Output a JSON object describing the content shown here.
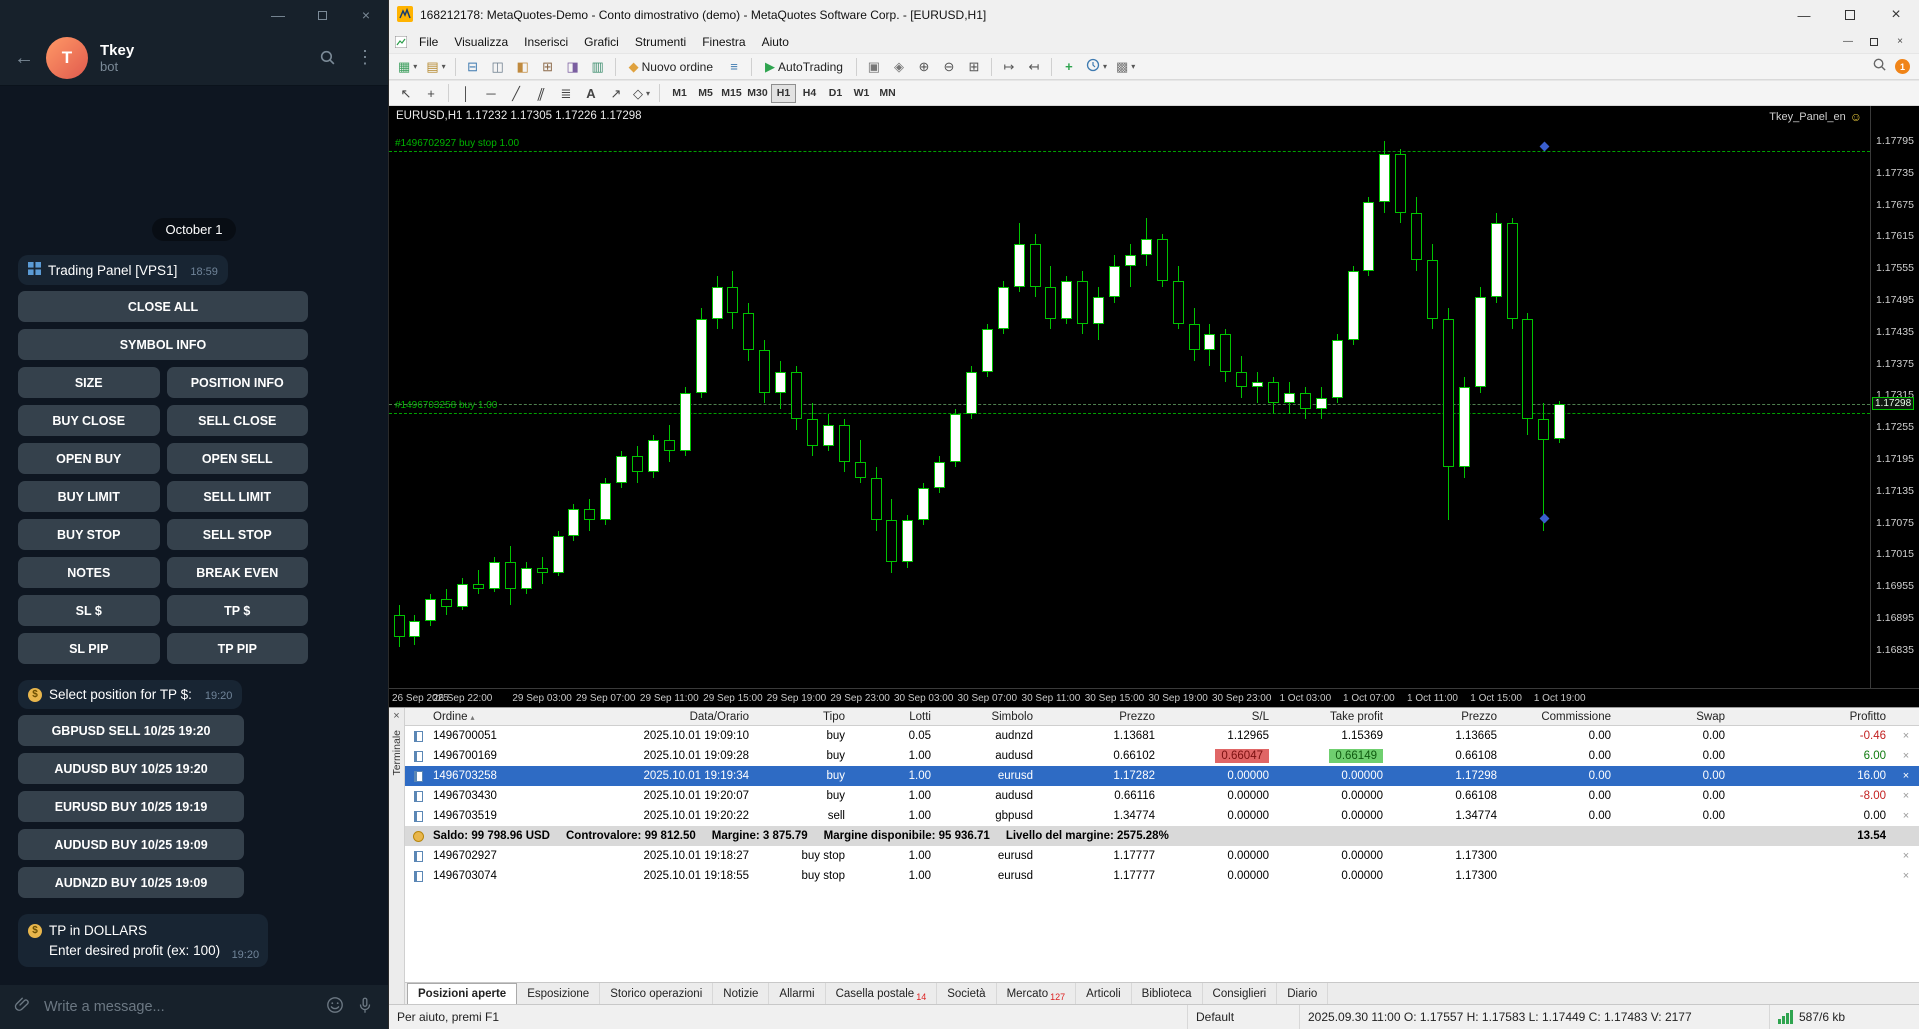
{
  "telegram": {
    "header": {
      "title": "Tkey",
      "subtitle": "bot",
      "avatar_letter": "T"
    },
    "date_separator": "October 1",
    "messages": {
      "panel": {
        "text": "Trading Panel [VPS1]",
        "time": "18:59"
      },
      "select": {
        "text": "Select position for TP $:",
        "time": "19:20"
      },
      "tp": {
        "line1": "TP in DOLLARS",
        "line2": "Enter desired profit (ex: 100)",
        "time": "19:20"
      }
    },
    "keyboard_rows": [
      [
        "CLOSE ALL"
      ],
      [
        "SYMBOL INFO"
      ],
      [
        "SIZE",
        "POSITION INFO"
      ],
      [
        "BUY CLOSE",
        "SELL CLOSE"
      ],
      [
        "OPEN BUY",
        "OPEN SELL"
      ],
      [
        "BUY LIMIT",
        "SELL LIMIT"
      ],
      [
        "BUY STOP",
        "SELL STOP"
      ],
      [
        "NOTES",
        "BREAK EVEN"
      ],
      [
        "SL $",
        "TP $"
      ],
      [
        "SL PIP",
        "TP PIP"
      ]
    ],
    "position_buttons": [
      "GBPUSD SELL 10/25 19:20",
      "AUDUSD BUY 10/25 19:20",
      "EURUSD BUY 10/25 19:19",
      "AUDUSD BUY 10/25 19:09",
      "AUDNZD BUY 10/25 19:09"
    ],
    "composer": {
      "placeholder": "Write a message..."
    }
  },
  "mt5": {
    "titlebar": {
      "title": "168212178: MetaQuotes-Demo - Conto dimostrativo (demo) - MetaQuotes Software Corp. - [EURUSD,H1]"
    },
    "menu": [
      "File",
      "Visualizza",
      "Inserisci",
      "Grafici",
      "Strumenti",
      "Finestra",
      "Aiuto"
    ],
    "toolbar": {
      "new_order_label": "Nuovo ordine",
      "autotrading_label": "AutoTrading",
      "notification_count": "1"
    },
    "timeframes": {
      "items": [
        "M1",
        "M5",
        "M15",
        "M30",
        "H1",
        "H4",
        "D1",
        "W1",
        "MN"
      ],
      "active": "H1"
    },
    "chart": {
      "info_line": "EURUSD,H1 1.17232 1.17305 1.17226 1.17298",
      "ea_label": "Tkey_Panel_en",
      "orders": [
        {
          "label": "#1496702927 buy stop 1.00",
          "price": 1.17777
        },
        {
          "label": "#1496703258 buy 1.00",
          "price": 1.17282
        }
      ],
      "current_price": 1.17298,
      "markers": [
        {
          "bar": 72,
          "price": 1.17784
        },
        {
          "bar": 72,
          "price": 1.17082
        }
      ],
      "price_axis": {
        "top_price": 1.17861,
        "bottom_price": 1.16763,
        "labels": [
          "1.17795",
          "1.17735",
          "1.17675",
          "1.17615",
          "1.17555",
          "1.17495",
          "1.17435",
          "1.17375",
          "1.17315",
          "1.17255",
          "1.17195",
          "1.17135",
          "1.17075",
          "1.17015",
          "1.16955",
          "1.16895",
          "1.16835"
        ]
      },
      "time_labels": [
        {
          "text": "26 Sep 2025",
          "bar": 0
        },
        {
          "text": "26 Sep 22:00",
          "bar": 4
        },
        {
          "text": "29 Sep 03:00",
          "bar": 9
        },
        {
          "text": "29 Sep 07:00",
          "bar": 13
        },
        {
          "text": "29 Sep 11:00",
          "bar": 17
        },
        {
          "text": "29 Sep 15:00",
          "bar": 21
        },
        {
          "text": "29 Sep 19:00",
          "bar": 25
        },
        {
          "text": "29 Sep 23:00",
          "bar": 29
        },
        {
          "text": "30 Sep 03:00",
          "bar": 33
        },
        {
          "text": "30 Sep 07:00",
          "bar": 37
        },
        {
          "text": "30 Sep 11:00",
          "bar": 41
        },
        {
          "text": "30 Sep 15:00",
          "bar": 45
        },
        {
          "text": "30 Sep 19:00",
          "bar": 49
        },
        {
          "text": "30 Sep 23:00",
          "bar": 53
        },
        {
          "text": "1 Oct 03:00",
          "bar": 57
        },
        {
          "text": "1 Oct 07:00",
          "bar": 61
        },
        {
          "text": "1 Oct 11:00",
          "bar": 65
        },
        {
          "text": "1 Oct 15:00",
          "bar": 69
        },
        {
          "text": "1 Oct 19:00",
          "bar": 73
        }
      ]
    },
    "chart_data": {
      "type": "candlestick",
      "symbol": "EURUSD",
      "timeframe": "H1",
      "ylim": [
        1.16763,
        1.17861
      ],
      "ohlc": [
        [
          1.169,
          1.1692,
          1.1684,
          1.1686
        ],
        [
          1.1686,
          1.169,
          1.16845,
          1.1689
        ],
        [
          1.1689,
          1.1694,
          1.1688,
          1.1693
        ],
        [
          1.1693,
          1.1695,
          1.169,
          1.16915
        ],
        [
          1.16915,
          1.1697,
          1.1691,
          1.1696
        ],
        [
          1.1696,
          1.16985,
          1.1694,
          1.1695
        ],
        [
          1.1695,
          1.1701,
          1.16945,
          1.17
        ],
        [
          1.17,
          1.1703,
          1.1692,
          1.1695
        ],
        [
          1.1695,
          1.17,
          1.1694,
          1.1699
        ],
        [
          1.1699,
          1.1701,
          1.1696,
          1.1698
        ],
        [
          1.1698,
          1.1706,
          1.16975,
          1.1705
        ],
        [
          1.1705,
          1.1711,
          1.1704,
          1.171
        ],
        [
          1.171,
          1.1712,
          1.1706,
          1.1708
        ],
        [
          1.1708,
          1.1716,
          1.1707,
          1.1715
        ],
        [
          1.1715,
          1.1721,
          1.1714,
          1.172
        ],
        [
          1.172,
          1.1722,
          1.1715,
          1.1717
        ],
        [
          1.1717,
          1.1724,
          1.1716,
          1.1723
        ],
        [
          1.1723,
          1.1726,
          1.1719,
          1.1721
        ],
        [
          1.1721,
          1.1733,
          1.172,
          1.1732
        ],
        [
          1.1732,
          1.1748,
          1.1731,
          1.1746
        ],
        [
          1.1746,
          1.1754,
          1.1744,
          1.1752
        ],
        [
          1.1752,
          1.1755,
          1.1744,
          1.1747
        ],
        [
          1.1747,
          1.1749,
          1.1738,
          1.174
        ],
        [
          1.174,
          1.1742,
          1.173,
          1.1732
        ],
        [
          1.1732,
          1.1738,
          1.1729,
          1.1736
        ],
        [
          1.1736,
          1.1737,
          1.1725,
          1.1727
        ],
        [
          1.1727,
          1.173,
          1.172,
          1.1722
        ],
        [
          1.1722,
          1.1728,
          1.1721,
          1.1726
        ],
        [
          1.1726,
          1.1727,
          1.1717,
          1.1719
        ],
        [
          1.1719,
          1.1723,
          1.1715,
          1.1716
        ],
        [
          1.1716,
          1.1718,
          1.1706,
          1.1708
        ],
        [
          1.1708,
          1.1712,
          1.1698,
          1.17
        ],
        [
          1.17,
          1.1709,
          1.1699,
          1.1708
        ],
        [
          1.1708,
          1.1715,
          1.1707,
          1.1714
        ],
        [
          1.1714,
          1.172,
          1.1713,
          1.1719
        ],
        [
          1.1719,
          1.1729,
          1.1718,
          1.1728
        ],
        [
          1.1728,
          1.1737,
          1.1727,
          1.1736
        ],
        [
          1.1736,
          1.1745,
          1.1735,
          1.1744
        ],
        [
          1.1744,
          1.1753,
          1.1743,
          1.1752
        ],
        [
          1.1752,
          1.1764,
          1.1751,
          1.176
        ],
        [
          1.176,
          1.1762,
          1.175,
          1.1752
        ],
        [
          1.1752,
          1.1756,
          1.1744,
          1.1746
        ],
        [
          1.1746,
          1.1754,
          1.1745,
          1.1753
        ],
        [
          1.1753,
          1.1755,
          1.1743,
          1.1745
        ],
        [
          1.1745,
          1.1752,
          1.1742,
          1.175
        ],
        [
          1.175,
          1.1758,
          1.1749,
          1.1756
        ],
        [
          1.1756,
          1.176,
          1.1752,
          1.1758
        ],
        [
          1.1758,
          1.1765,
          1.1756,
          1.1761
        ],
        [
          1.1761,
          1.1762,
          1.1752,
          1.1753
        ],
        [
          1.1753,
          1.1756,
          1.1744,
          1.1745
        ],
        [
          1.1745,
          1.1748,
          1.1738,
          1.174
        ],
        [
          1.174,
          1.1745,
          1.1737,
          1.1743
        ],
        [
          1.1743,
          1.1744,
          1.1734,
          1.1736
        ],
        [
          1.1736,
          1.1739,
          1.1731,
          1.1733
        ],
        [
          1.1733,
          1.1736,
          1.173,
          1.1734
        ],
        [
          1.1734,
          1.1735,
          1.1728,
          1.173
        ],
        [
          1.173,
          1.1734,
          1.1728,
          1.1732
        ],
        [
          1.1732,
          1.1733,
          1.1727,
          1.1729
        ],
        [
          1.1729,
          1.1733,
          1.1727,
          1.1731
        ],
        [
          1.1731,
          1.1743,
          1.173,
          1.1742
        ],
        [
          1.1742,
          1.1756,
          1.1741,
          1.1755
        ],
        [
          1.1755,
          1.1769,
          1.1754,
          1.1768
        ],
        [
          1.1768,
          1.17795,
          1.1766,
          1.1777
        ],
        [
          1.1777,
          1.1778,
          1.1764,
          1.1766
        ],
        [
          1.1766,
          1.1769,
          1.1755,
          1.1757
        ],
        [
          1.1757,
          1.176,
          1.1744,
          1.1746
        ],
        [
          1.1746,
          1.1748,
          1.1708,
          1.1718
        ],
        [
          1.1718,
          1.1735,
          1.1716,
          1.1733
        ],
        [
          1.1733,
          1.1752,
          1.1732,
          1.175
        ],
        [
          1.175,
          1.1766,
          1.1749,
          1.1764
        ],
        [
          1.1764,
          1.1765,
          1.1744,
          1.1746
        ],
        [
          1.1746,
          1.1747,
          1.1724,
          1.1727
        ],
        [
          1.1727,
          1.173,
          1.1706,
          1.1723
        ],
        [
          1.17232,
          1.17305,
          1.17226,
          1.17298
        ]
      ]
    },
    "terminal": {
      "side_label": "Terminale",
      "sorted_column": "Ordine",
      "columns": [
        "Ordine",
        "Data/Orario",
        "Tipo",
        "Lotti",
        "Simbolo",
        "Prezzo",
        "S/L",
        "Take profit",
        "Prezzo",
        "Commissione",
        "Swap",
        "Profitto"
      ],
      "rows": [
        {
          "order": "1496700051",
          "time": "2025.10.01 19:09:10",
          "type": "buy",
          "lots": "0.05",
          "symbol": "audnzd",
          "price": "1.13681",
          "sl": "1.12965",
          "tp": "1.15369",
          "price2": "1.13665",
          "commission": "0.00",
          "swap": "0.00",
          "profit": "-0.46",
          "profit_class": "neg"
        },
        {
          "order": "1496700169",
          "time": "2025.10.01 19:09:28",
          "type": "buy",
          "lots": "1.00",
          "symbol": "audusd",
          "price": "0.66102",
          "sl": "0.66047",
          "sl_hl": true,
          "tp": "0.66149",
          "tp_hl": true,
          "price2": "0.66108",
          "commission": "0.00",
          "swap": "0.00",
          "profit": "6.00",
          "profit_class": "pos"
        },
        {
          "order": "1496703258",
          "time": "2025.10.01 19:19:34",
          "type": "buy",
          "lots": "1.00",
          "symbol": "eurusd",
          "price": "1.17282",
          "sl": "0.00000",
          "tp": "0.00000",
          "price2": "1.17298",
          "commission": "0.00",
          "swap": "0.00",
          "profit": "16.00",
          "profit_class": "pos",
          "selected": true
        },
        {
          "order": "1496703430",
          "time": "2025.10.01 19:20:07",
          "type": "buy",
          "lots": "1.00",
          "symbol": "audusd",
          "price": "0.66116",
          "sl": "0.00000",
          "tp": "0.00000",
          "price2": "0.66108",
          "commission": "0.00",
          "swap": "0.00",
          "profit": "-8.00",
          "profit_class": "neg"
        },
        {
          "order": "1496703519",
          "time": "2025.10.01 19:20:22",
          "type": "sell",
          "lots": "1.00",
          "symbol": "gbpusd",
          "price": "1.34774",
          "sl": "0.00000",
          "tp": "0.00000",
          "price2": "1.34774",
          "commission": "0.00",
          "swap": "0.00",
          "profit": "0.00",
          "profit_class": "zero"
        }
      ],
      "balance": {
        "segments": [
          "Saldo: 99 798.96 USD",
          "Controvalore: 99 812.50",
          "Margine: 3 875.79",
          "Margine disponibile: 95 936.71",
          "Livello del margine: 2575.28%"
        ],
        "profit": "13.54"
      },
      "pending_rows": [
        {
          "order": "1496702927",
          "time": "2025.10.01 19:18:27",
          "type": "buy stop",
          "lots": "1.00",
          "symbol": "eurusd",
          "price": "1.17777",
          "sl": "0.00000",
          "tp": "0.00000",
          "price2": "1.17300",
          "commission": "",
          "swap": "",
          "profit": "",
          "profit_class": "zero"
        },
        {
          "order": "1496703074",
          "time": "2025.10.01 19:18:55",
          "type": "buy stop",
          "lots": "1.00",
          "symbol": "eurusd",
          "price": "1.17777",
          "sl": "0.00000",
          "tp": "0.00000",
          "price2": "1.17300",
          "commission": "",
          "swap": "",
          "profit": "",
          "profit_class": "zero"
        }
      ],
      "tabs": [
        {
          "label": "Posizioni aperte",
          "active": true
        },
        {
          "label": "Esposizione"
        },
        {
          "label": "Storico operazioni"
        },
        {
          "label": "Notizie"
        },
        {
          "label": "Allarmi"
        },
        {
          "label": "Casella postale",
          "badge": "14"
        },
        {
          "label": "Società"
        },
        {
          "label": "Mercato",
          "badge": "127"
        },
        {
          "label": "Articoli"
        },
        {
          "label": "Biblioteca"
        },
        {
          "label": "Consiglieri"
        },
        {
          "label": "Diario"
        }
      ]
    },
    "status_bar": {
      "help": "Per aiuto, premi F1",
      "profile": "Default",
      "quote": "2025.09.30 11:00   O: 1.17557   H: 1.17583   L: 1.17449   C: 1.17483   V: 2177",
      "traffic": "587/6 kb"
    }
  }
}
